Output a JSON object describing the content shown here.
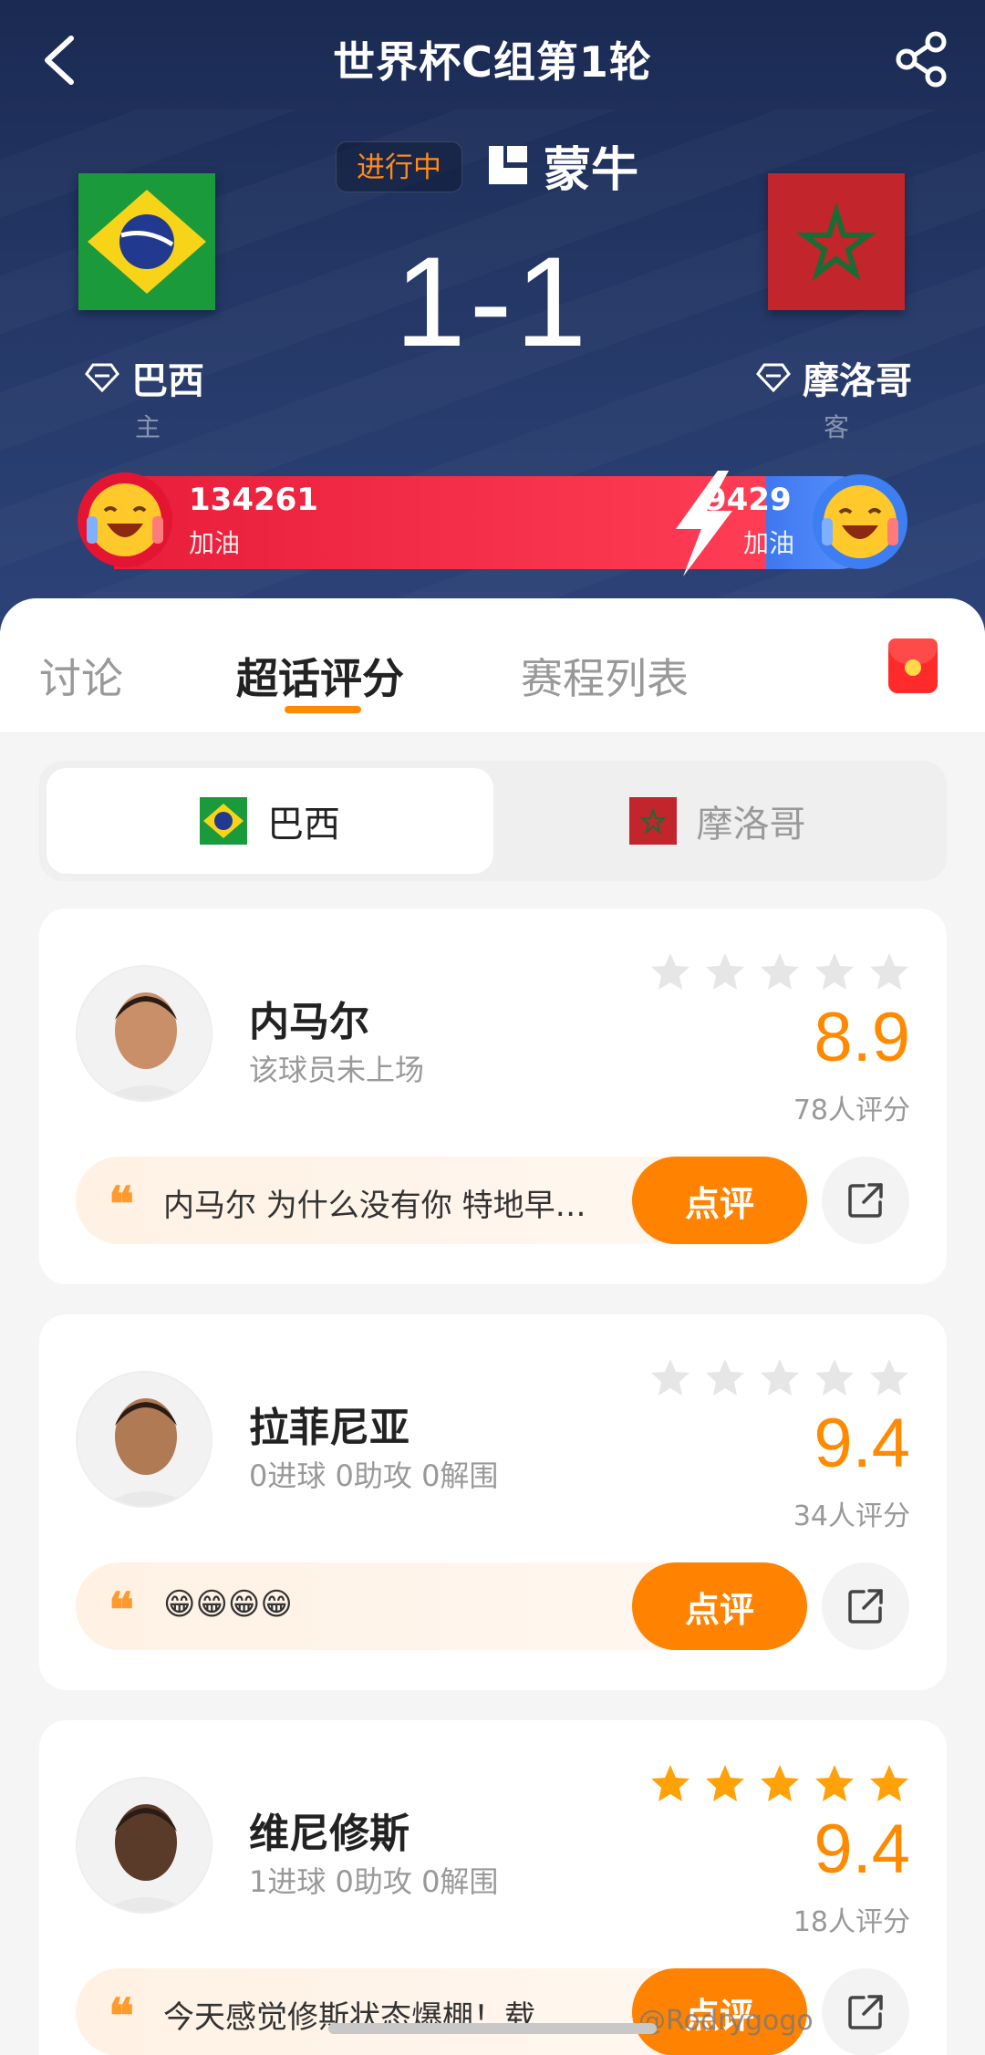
{
  "nav": {
    "title": "世界杯C组第1轮"
  },
  "match": {
    "status": "进行中",
    "sponsor": "蒙牛",
    "score": "1-1",
    "home": {
      "name": "巴西",
      "role": "主"
    },
    "away": {
      "name": "摩洛哥",
      "role": "客"
    }
  },
  "cheer": {
    "home_count": "134261",
    "home_label": "加油",
    "away_count": "9429",
    "away_label": "加油"
  },
  "tabs": [
    {
      "label": "讨论"
    },
    {
      "label": "超话评分"
    },
    {
      "label": "赛程列表"
    }
  ],
  "team_switch": [
    {
      "label": "巴西"
    },
    {
      "label": "摩洛哥"
    }
  ],
  "players": [
    {
      "name": "内马尔",
      "stat": "该球员未上场",
      "score": "8.9",
      "count": "78人评分",
      "stars": 0,
      "comment": "内马尔 为什么没有你 特地早…",
      "review_label": "点评"
    },
    {
      "name": "拉菲尼亚",
      "stat": "0进球 0助攻 0解围",
      "score": "9.4",
      "count": "34人评分",
      "stars": 0,
      "comment": "😁😁😁😁",
      "review_label": "点评"
    },
    {
      "name": "维尼修斯",
      "stat": "1进球 0助攻 0解围",
      "score": "9.4",
      "count": "18人评分",
      "stars": 5,
      "comment": "今天感觉修斯状态爆棚！载",
      "review_label": "点评"
    }
  ],
  "watermark": "@Rodrygogo",
  "colors": {
    "accent": "#ff8a00",
    "home_bar": "#e81d3a",
    "away_bar": "#3e78f0",
    "header_bg": "#1f2f5c"
  }
}
